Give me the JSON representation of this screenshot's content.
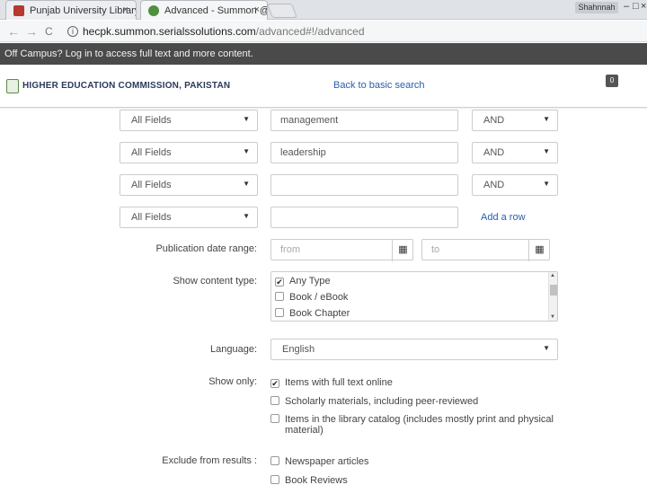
{
  "browser": {
    "tabs": [
      {
        "title": "Punjab University Library",
        "close": "×"
      },
      {
        "title": "Advanced - Summon @ H",
        "close": "×"
      }
    ],
    "profile_label": "Shahnnah",
    "controls": {
      "minimize": "–",
      "maximize": "□",
      "close": "×"
    },
    "nav": {
      "back": "←",
      "forward": "→",
      "reload": "C"
    },
    "url_host": "hecpk.summon.serialssolutions.com",
    "url_path": "/advanced#!/advanced"
  },
  "banner": {
    "text": "Off Campus? Log in to access full text and more content."
  },
  "header": {
    "brand": "HIGHER EDUCATION COMMISSION, PAKISTAN",
    "back_link": "Back to basic search",
    "badge": "0"
  },
  "search_rows": [
    {
      "field": "All Fields",
      "value": "management",
      "operator": "AND"
    },
    {
      "field": "All Fields",
      "value": "leadership",
      "operator": "AND"
    },
    {
      "field": "All Fields",
      "value": "",
      "operator": "AND"
    },
    {
      "field": "All Fields",
      "value": ""
    }
  ],
  "add_row": "Add a row",
  "publication_date": {
    "label": "Publication date range:",
    "from_placeholder": "from",
    "to_placeholder": "to"
  },
  "content_type": {
    "label": "Show content type:",
    "items": [
      {
        "label": "Any Type",
        "checked": true
      },
      {
        "label": "Book / eBook",
        "checked": false
      },
      {
        "label": "Book Chapter",
        "checked": false
      }
    ]
  },
  "language": {
    "label": "Language:",
    "value": "English"
  },
  "show_only": {
    "label": "Show only:",
    "items": [
      {
        "label": "Items with full text online",
        "checked": true
      },
      {
        "label": "Scholarly materials, including peer-reviewed",
        "checked": false
      },
      {
        "label": "Items in the library catalog (includes mostly print and physical material)",
        "checked": false
      }
    ]
  },
  "exclude": {
    "label": "Exclude from results :",
    "items": [
      {
        "label": "Newspaper articles",
        "checked": false
      },
      {
        "label": "Book Reviews",
        "checked": false
      }
    ]
  },
  "icons": {
    "calendar": "calendar-icon",
    "caret": "caret-down-icon",
    "info": "info-icon",
    "checkbox": "checkbox-icon"
  },
  "colors": {
    "banner_bg": "#4a4a4a",
    "link": "#2a5db0",
    "brand": "#2a3a5a"
  }
}
